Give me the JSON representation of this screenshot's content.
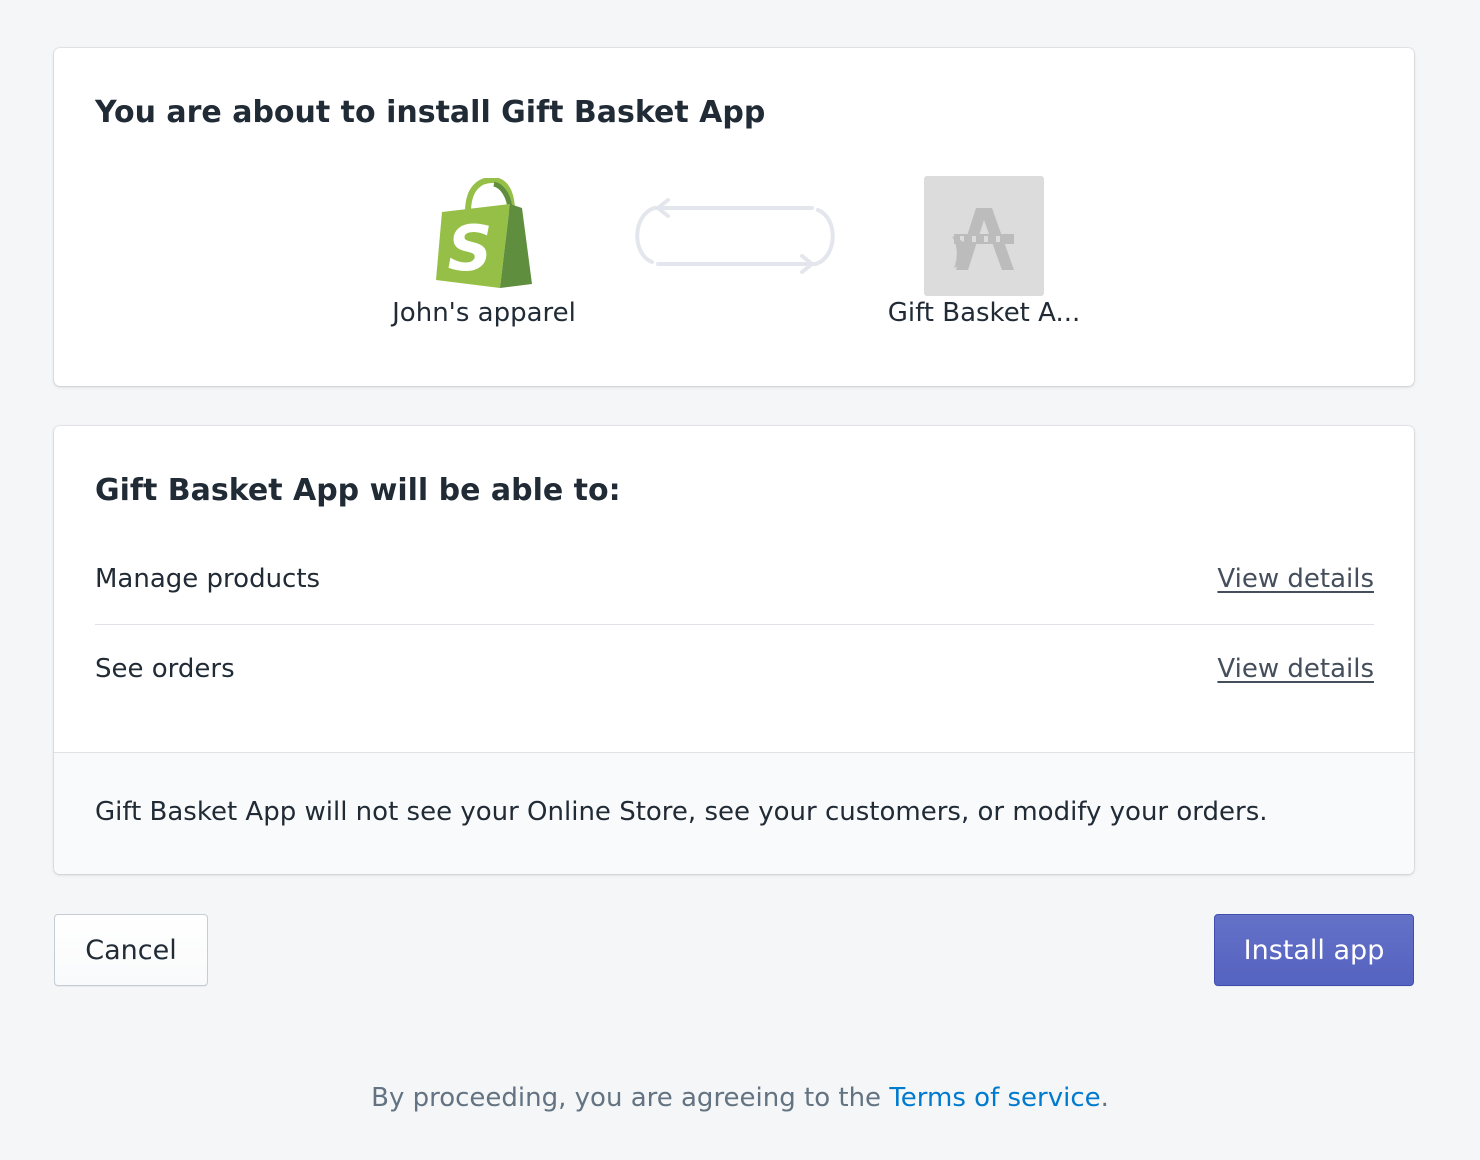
{
  "install": {
    "title": "You are about to install Gift Basket App",
    "store_name": "John's apparel",
    "app_name": "Gift Basket A..."
  },
  "permissions": {
    "title": "Gift Basket App will be able to:",
    "items": [
      {
        "label": "Manage products",
        "link": "View details"
      },
      {
        "label": "See orders",
        "link": "View details"
      }
    ],
    "note": "Gift Basket App will not see your Online Store, see your customers, or modify your orders."
  },
  "actions": {
    "cancel_label": "Cancel",
    "install_label": "Install app"
  },
  "terms": {
    "prefix": "By proceeding, you are agreeing to the ",
    "link": "Terms of service",
    "suffix": "."
  },
  "colors": {
    "primary": "#5c6ac4",
    "link": "#007ace",
    "shopify_green": "#95bf47",
    "background": "#f4f6f8"
  },
  "icons": {
    "store": "shopify-bag-icon",
    "sync": "sync-arrows-icon",
    "app": "app-placeholder-icon"
  }
}
